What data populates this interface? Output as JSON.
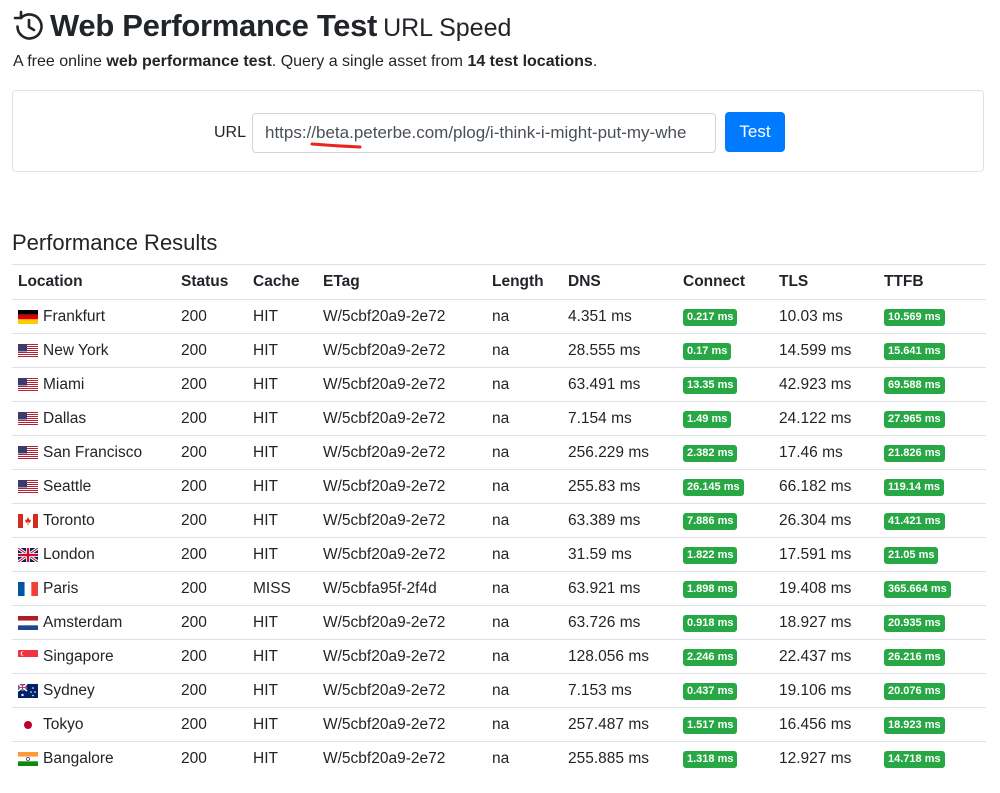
{
  "header": {
    "title": "Web Performance Test",
    "title_suffix": "URL Speed",
    "tagline_prefix": "A free online ",
    "tagline_bold1": "web performance test",
    "tagline_mid": ". Query a single asset from ",
    "tagline_bold2": "14 test locations",
    "tagline_end": "."
  },
  "form": {
    "url_label": "URL",
    "url_value": "https://beta.peterbe.com/plog/i-think-i-might-put-my-whe",
    "submit_label": "Test",
    "accent": "#007bff"
  },
  "results": {
    "heading": "Performance Results",
    "columns": [
      "Location",
      "Status",
      "Cache",
      "ETag",
      "Length",
      "DNS",
      "Connect",
      "TLS",
      "TTFB"
    ],
    "badge_color": "#28a745",
    "rows": [
      {
        "flag": "de",
        "location": "Frankfurt",
        "status": "200",
        "cache": "HIT",
        "etag": "W/5cbf20a9-2e72",
        "length": "na",
        "dns": "4.351 ms",
        "connect": "0.217 ms",
        "tls": "10.03 ms",
        "ttfb": "10.569 ms"
      },
      {
        "flag": "us",
        "location": "New York",
        "status": "200",
        "cache": "HIT",
        "etag": "W/5cbf20a9-2e72",
        "length": "na",
        "dns": "28.555 ms",
        "connect": "0.17 ms",
        "tls": "14.599 ms",
        "ttfb": "15.641 ms"
      },
      {
        "flag": "us",
        "location": "Miami",
        "status": "200",
        "cache": "HIT",
        "etag": "W/5cbf20a9-2e72",
        "length": "na",
        "dns": "63.491 ms",
        "connect": "13.35 ms",
        "tls": "42.923 ms",
        "ttfb": "69.588 ms"
      },
      {
        "flag": "us",
        "location": "Dallas",
        "status": "200",
        "cache": "HIT",
        "etag": "W/5cbf20a9-2e72",
        "length": "na",
        "dns": "7.154 ms",
        "connect": "1.49 ms",
        "tls": "24.122 ms",
        "ttfb": "27.965 ms"
      },
      {
        "flag": "us",
        "location": "San Francisco",
        "status": "200",
        "cache": "HIT",
        "etag": "W/5cbf20a9-2e72",
        "length": "na",
        "dns": "256.229 ms",
        "connect": "2.382 ms",
        "tls": "17.46 ms",
        "ttfb": "21.826 ms"
      },
      {
        "flag": "us",
        "location": "Seattle",
        "status": "200",
        "cache": "HIT",
        "etag": "W/5cbf20a9-2e72",
        "length": "na",
        "dns": "255.83 ms",
        "connect": "26.145 ms",
        "tls": "66.182 ms",
        "ttfb": "119.14 ms"
      },
      {
        "flag": "ca",
        "location": "Toronto",
        "status": "200",
        "cache": "HIT",
        "etag": "W/5cbf20a9-2e72",
        "length": "na",
        "dns": "63.389 ms",
        "connect": "7.886 ms",
        "tls": "26.304 ms",
        "ttfb": "41.421 ms"
      },
      {
        "flag": "gb",
        "location": "London",
        "status": "200",
        "cache": "HIT",
        "etag": "W/5cbf20a9-2e72",
        "length": "na",
        "dns": "31.59 ms",
        "connect": "1.822 ms",
        "tls": "17.591 ms",
        "ttfb": "21.05 ms"
      },
      {
        "flag": "fr",
        "location": "Paris",
        "status": "200",
        "cache": "MISS",
        "etag": "W/5cbfa95f-2f4d",
        "length": "na",
        "dns": "63.921 ms",
        "connect": "1.898 ms",
        "tls": "19.408 ms",
        "ttfb": "365.664 ms"
      },
      {
        "flag": "nl",
        "location": "Amsterdam",
        "status": "200",
        "cache": "HIT",
        "etag": "W/5cbf20a9-2e72",
        "length": "na",
        "dns": "63.726 ms",
        "connect": "0.918 ms",
        "tls": "18.927 ms",
        "ttfb": "20.935 ms"
      },
      {
        "flag": "sg",
        "location": "Singapore",
        "status": "200",
        "cache": "HIT",
        "etag": "W/5cbf20a9-2e72",
        "length": "na",
        "dns": "128.056 ms",
        "connect": "2.246 ms",
        "tls": "22.437 ms",
        "ttfb": "26.216 ms"
      },
      {
        "flag": "au",
        "location": "Sydney",
        "status": "200",
        "cache": "HIT",
        "etag": "W/5cbf20a9-2e72",
        "length": "na",
        "dns": "7.153 ms",
        "connect": "0.437 ms",
        "tls": "19.106 ms",
        "ttfb": "20.076 ms"
      },
      {
        "flag": "jp",
        "location": "Tokyo",
        "status": "200",
        "cache": "HIT",
        "etag": "W/5cbf20a9-2e72",
        "length": "na",
        "dns": "257.487 ms",
        "connect": "1.517 ms",
        "tls": "16.456 ms",
        "ttfb": "18.923 ms"
      },
      {
        "flag": "in",
        "location": "Bangalore",
        "status": "200",
        "cache": "HIT",
        "etag": "W/5cbf20a9-2e72",
        "length": "na",
        "dns": "255.885 ms",
        "connect": "1.318 ms",
        "tls": "12.927 ms",
        "ttfb": "14.718 ms"
      }
    ]
  }
}
